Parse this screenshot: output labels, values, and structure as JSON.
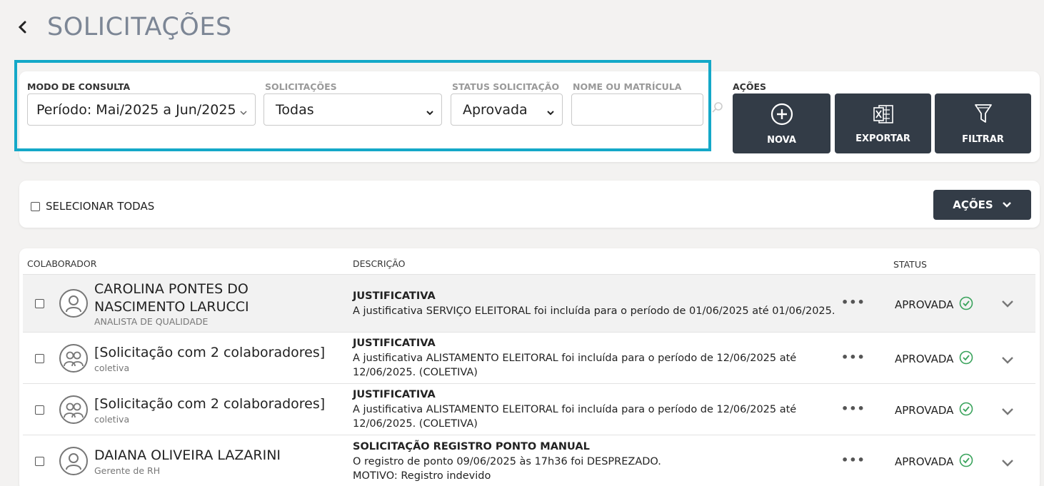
{
  "header": {
    "title": "SOLICITAÇÕES",
    "back_icon": "chevron-left-icon"
  },
  "filters": {
    "mode_label": "MODO DE CONSULTA",
    "mode_value": "Período: Mai/2025 a Jun/2025",
    "requests_label": "SOLICITAÇÕES",
    "requests_value": "Todas",
    "status_label": "STATUS SOLICITAÇÃO",
    "status_value": "Aprovada",
    "name_label": "NOME OU MATRÍCULA",
    "name_value": "",
    "search_icon": "search-icon"
  },
  "actions": {
    "label": "AÇÕES",
    "new_label": "NOVA",
    "export_label": "EXPORTAR",
    "filter_label": "FILTRAR"
  },
  "selection": {
    "select_all_label": "SELECIONAR TODAS",
    "actions_dropdown_label": "AÇÕES"
  },
  "table": {
    "columns": [
      "COLABORADOR",
      "DESCRIÇÃO",
      "STATUS"
    ],
    "rows": [
      {
        "name_line1": "CAROLINA PONTES DO",
        "name_line2": "NASCIMENTO LARUCCI",
        "subtitle": "ANALISTA DE QUALIDADE",
        "desc_title": "JUSTIFICATIVA",
        "desc_line1": "A justificativa SERVIÇO ELEITORAL foi incluída para o período de 01/06/2025 até 01/06/2025.",
        "desc_line2": "",
        "status": "APROVADA",
        "avatar": "single-user-icon"
      },
      {
        "name_line1": "[Solicitação com 2 colaboradores]",
        "subtitle": "coletiva",
        "desc_title": "JUSTIFICATIVA",
        "desc_line1": "A justificativa ALISTAMENTO ELEITORAL foi incluída para o período de 12/06/2025 até",
        "desc_line2": "12/06/2025. (COLETIVA)",
        "status": "APROVADA",
        "avatar": "group-users-icon"
      },
      {
        "name_line1": "[Solicitação com 2 colaboradores]",
        "subtitle": "coletiva",
        "desc_title": "JUSTIFICATIVA",
        "desc_line1": "A justificativa ALISTAMENTO ELEITORAL foi incluída para o período de 12/06/2025 até",
        "desc_line2": "12/06/2025. (COLETIVA)",
        "status": "APROVADA",
        "avatar": "group-users-icon"
      },
      {
        "name_line1": "DAIANA OLIVEIRA LAZARINI",
        "subtitle": "Gerente de RH",
        "desc_title": "SOLICITAÇÃO REGISTRO PONTO MANUAL",
        "desc_line1": "O registro de ponto 09/06/2025 às 17h36 foi DESPREZADO.",
        "desc_line2": "MOTIVO: Registro indevido",
        "status": "APROVADA",
        "avatar": "single-user-icon"
      }
    ]
  },
  "colors": {
    "accent_highlight": "#14a8c8",
    "button_dark": "#333c47",
    "status_ok": "#3aa35c",
    "title": "#7c8695"
  }
}
